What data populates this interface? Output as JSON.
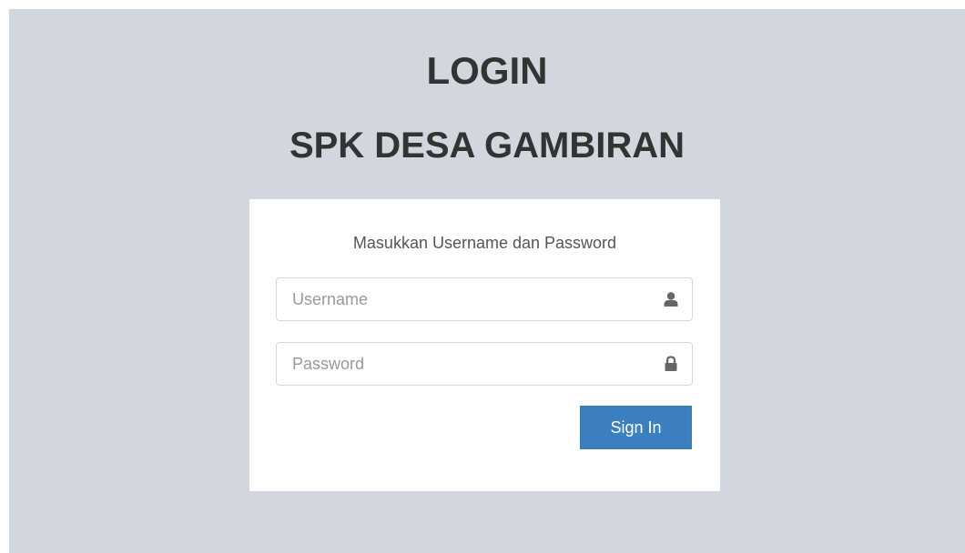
{
  "header": {
    "title": "LOGIN",
    "subtitle": "SPK DESA GAMBIRAN"
  },
  "login_box": {
    "message": "Masukkan Username dan Password",
    "username": {
      "placeholder": "Username",
      "value": "",
      "icon": "user-icon"
    },
    "password": {
      "placeholder": "Password",
      "value": "",
      "icon": "lock-icon"
    },
    "submit_label": "Sign In"
  },
  "colors": {
    "background": "#d2d6de",
    "box": "#ffffff",
    "button": "#3c7fbf",
    "heading": "#333333",
    "icon": "#666666"
  }
}
